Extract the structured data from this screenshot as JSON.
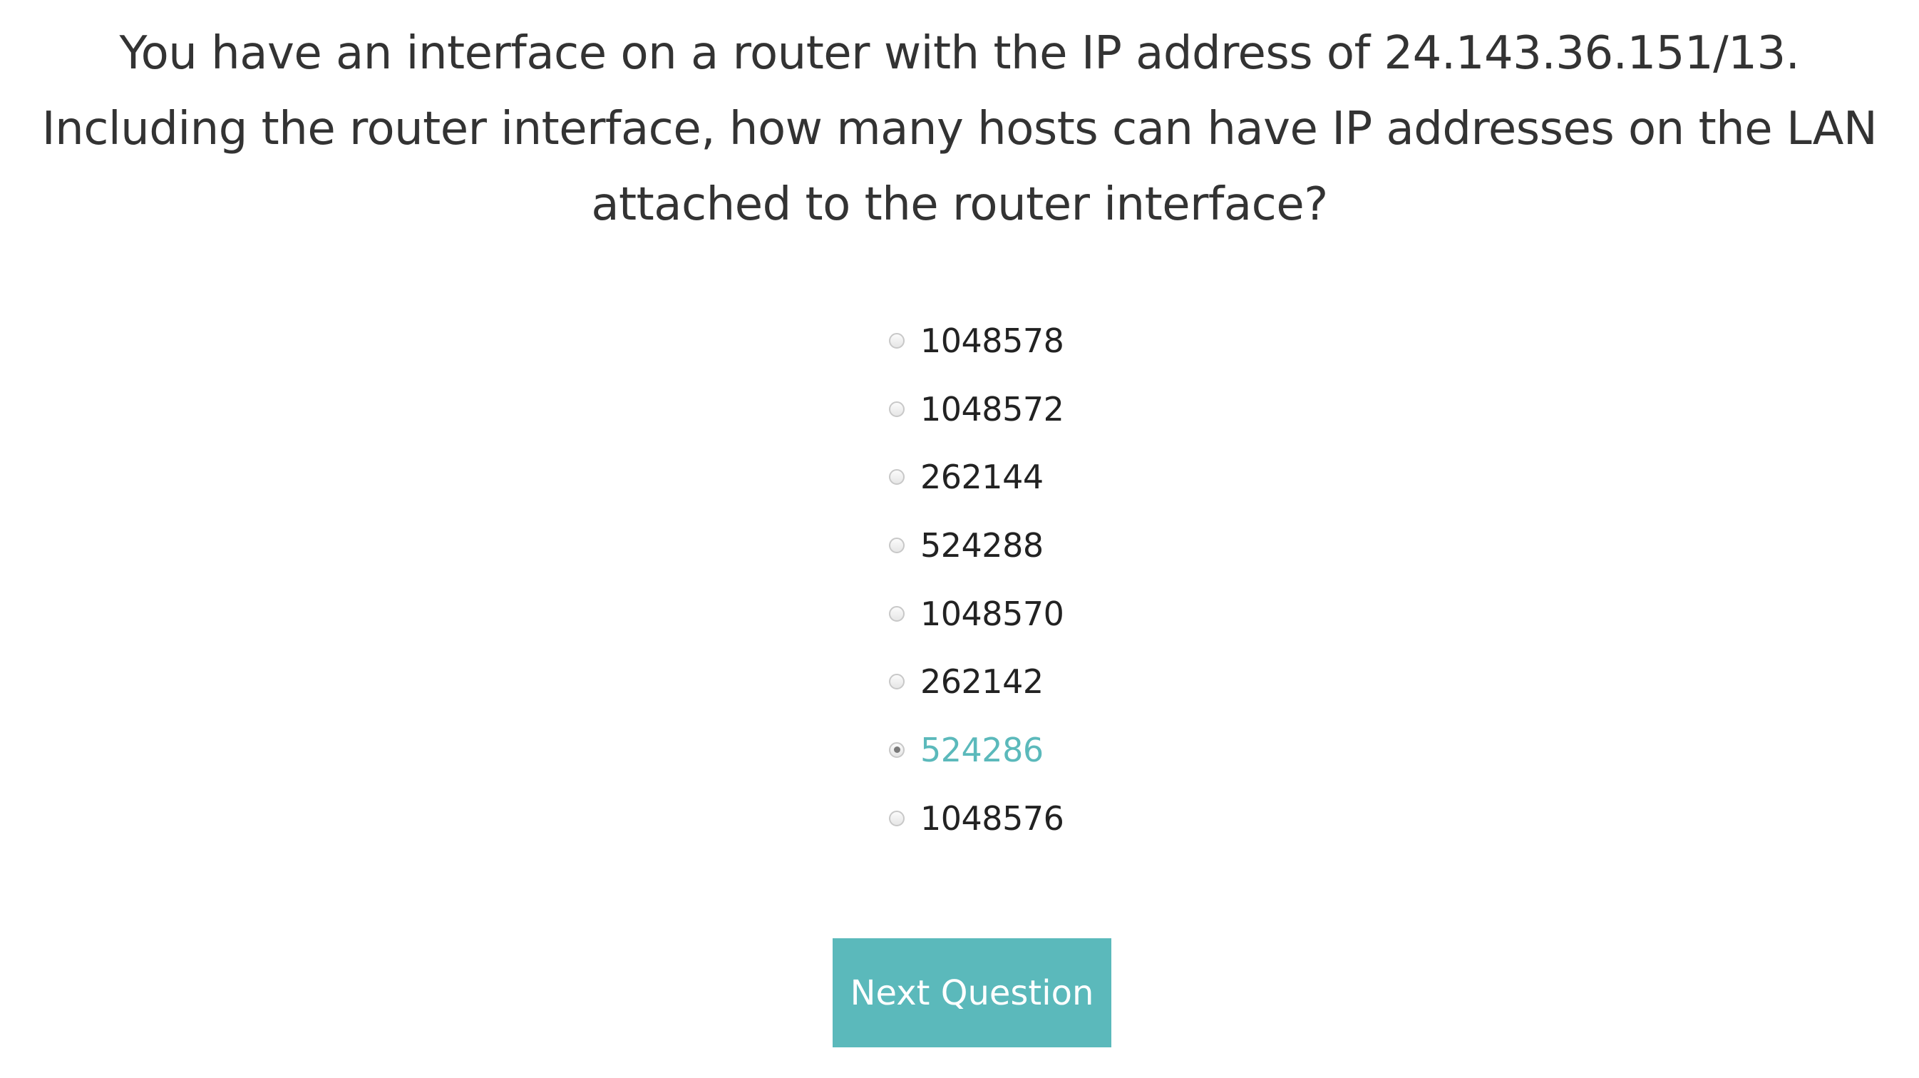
{
  "question": {
    "text": "You have an interface on a router with the IP address of 24.143.36.151/13. Including the router interface, how many hosts can have IP addresses on the LAN attached to the router interface?"
  },
  "options": [
    {
      "label": "1048578",
      "selected": false
    },
    {
      "label": "1048572",
      "selected": false
    },
    {
      "label": "262144",
      "selected": false
    },
    {
      "label": "524288",
      "selected": false
    },
    {
      "label": "1048570",
      "selected": false
    },
    {
      "label": "262142",
      "selected": false
    },
    {
      "label": "524286",
      "selected": true
    },
    {
      "label": "1048576",
      "selected": false
    }
  ],
  "next_button": {
    "label": "Next Question"
  },
  "colors": {
    "accent": "#5bb9bb",
    "text": "#333333",
    "background": "#ffffff"
  }
}
